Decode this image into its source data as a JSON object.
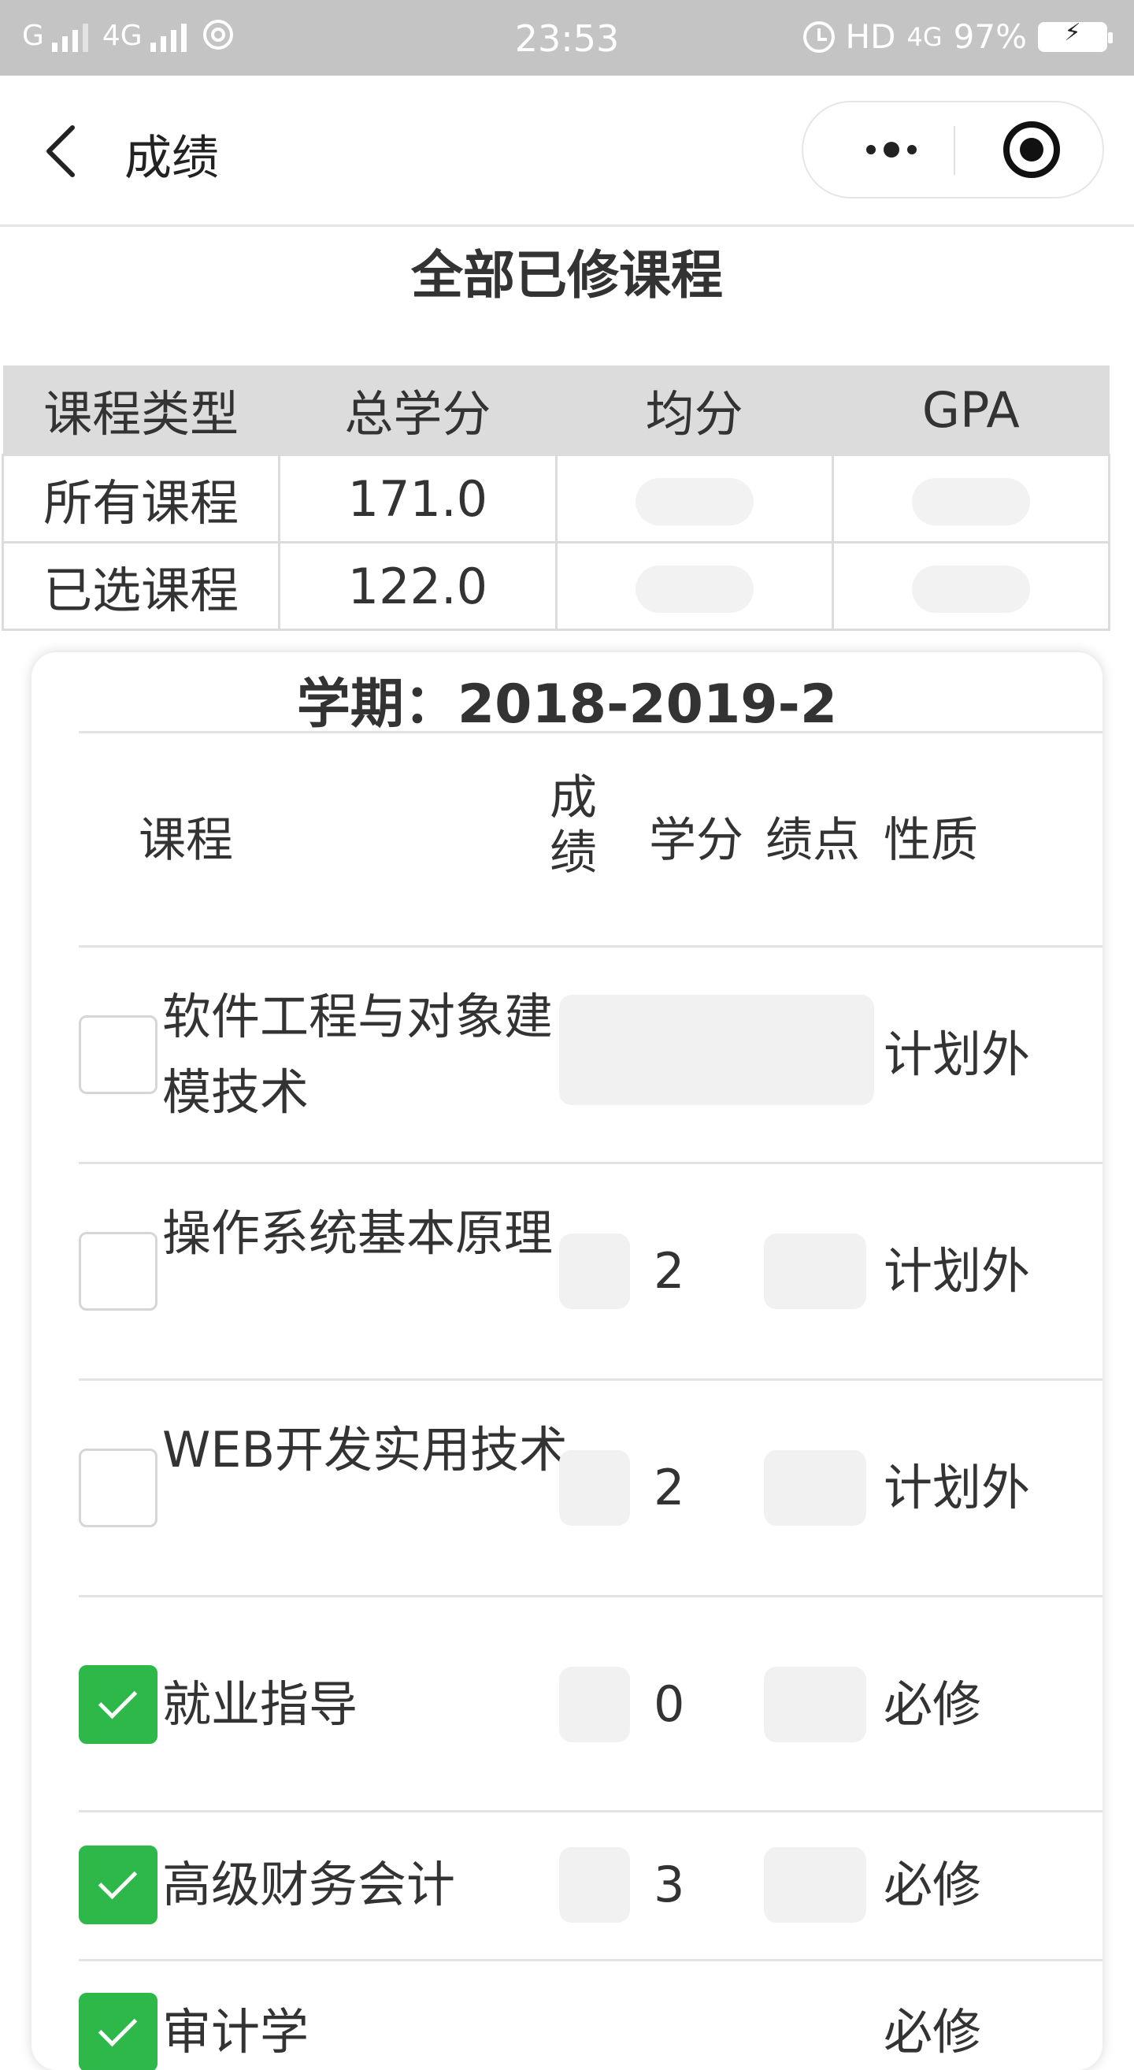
{
  "status_bar": {
    "sim1": "G",
    "sim2": "4G",
    "time": "23:53",
    "hd": "HD",
    "net": "4G",
    "battery": "97%"
  },
  "nav": {
    "title": "成绩"
  },
  "page": {
    "title": "全部已修课程"
  },
  "summary": {
    "headers": [
      "课程类型",
      "总学分",
      "均分",
      "GPA"
    ],
    "rows": [
      {
        "type": "所有课程",
        "credits": "171.0",
        "avg": "",
        "gpa": ""
      },
      {
        "type": "已选课程",
        "credits": "122.0",
        "avg": "",
        "gpa": ""
      }
    ]
  },
  "semester": {
    "title": "学期：2018-2019-2",
    "headers": {
      "course": "课程",
      "score": "成绩",
      "credit": "学分",
      "gpa": "绩点",
      "nature": "性质"
    },
    "courses": [
      {
        "name": "软件工程与对象建模技术",
        "checked": false,
        "score": "",
        "credit": "",
        "gpa": "",
        "nature": "计划外"
      },
      {
        "name": "操作系统基本原理",
        "checked": false,
        "score": "",
        "credit": "2",
        "gpa": "",
        "nature": "计划外"
      },
      {
        "name": "WEB开发实用技术",
        "checked": false,
        "score": "",
        "credit": "2",
        "gpa": "",
        "nature": "计划外"
      },
      {
        "name": "就业指导",
        "checked": true,
        "score": "",
        "credit": "0",
        "gpa": "",
        "nature": "必修"
      },
      {
        "name": "高级财务会计",
        "checked": true,
        "score": "",
        "credit": "3",
        "gpa": "",
        "nature": "必修"
      },
      {
        "name": "审计学",
        "checked": true,
        "score": "",
        "credit": "",
        "gpa": "",
        "nature": "必修"
      }
    ]
  },
  "colors": {
    "status_bar_bg": "#c4c4c4",
    "checkbox_checked": "#2fb84a",
    "table_header_bg": "#dcdcdc"
  },
  "icons": {
    "back": "chevron-left-icon",
    "more": "more-dots-icon",
    "close": "target-close-icon",
    "check": "check-icon"
  }
}
